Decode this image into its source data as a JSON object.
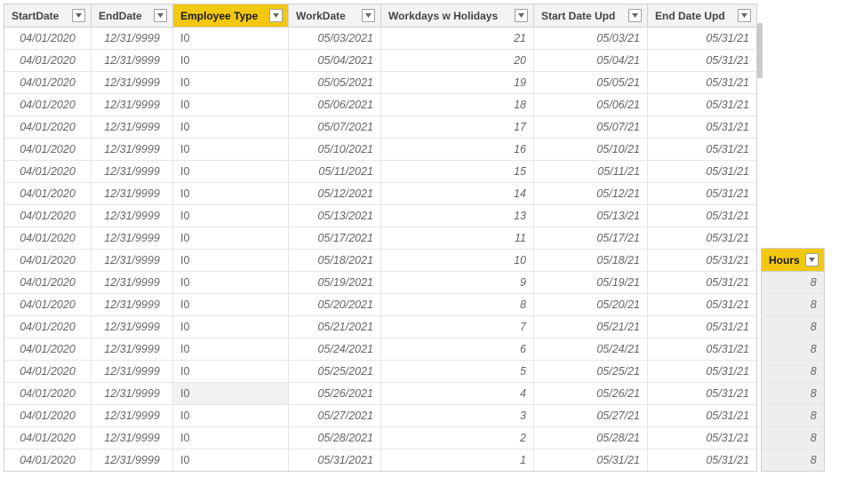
{
  "columns": {
    "start": "StartDate",
    "end": "EndDate",
    "emp": "Employee Type",
    "work": "WorkDate",
    "wd": "Workdays w Holidays",
    "supd": "Start Date Upd",
    "eupd": "End Date Upd",
    "hours": "Hours"
  },
  "rows": [
    {
      "start": "04/01/2020",
      "end": "12/31/9999",
      "emp": "I0",
      "work": "05/03/2021",
      "wd": "21",
      "supd": "05/03/21",
      "eupd": "05/31/21"
    },
    {
      "start": "04/01/2020",
      "end": "12/31/9999",
      "emp": "I0",
      "work": "05/04/2021",
      "wd": "20",
      "supd": "05/04/21",
      "eupd": "05/31/21"
    },
    {
      "start": "04/01/2020",
      "end": "12/31/9999",
      "emp": "I0",
      "work": "05/05/2021",
      "wd": "19",
      "supd": "05/05/21",
      "eupd": "05/31/21"
    },
    {
      "start": "04/01/2020",
      "end": "12/31/9999",
      "emp": "I0",
      "work": "05/06/2021",
      "wd": "18",
      "supd": "05/06/21",
      "eupd": "05/31/21"
    },
    {
      "start": "04/01/2020",
      "end": "12/31/9999",
      "emp": "I0",
      "work": "05/07/2021",
      "wd": "17",
      "supd": "05/07/21",
      "eupd": "05/31/21"
    },
    {
      "start": "04/01/2020",
      "end": "12/31/9999",
      "emp": "I0",
      "work": "05/10/2021",
      "wd": "16",
      "supd": "05/10/21",
      "eupd": "05/31/21"
    },
    {
      "start": "04/01/2020",
      "end": "12/31/9999",
      "emp": "I0",
      "work": "05/11/2021",
      "wd": "15",
      "supd": "05/11/21",
      "eupd": "05/31/21"
    },
    {
      "start": "04/01/2020",
      "end": "12/31/9999",
      "emp": "I0",
      "work": "05/12/2021",
      "wd": "14",
      "supd": "05/12/21",
      "eupd": "05/31/21"
    },
    {
      "start": "04/01/2020",
      "end": "12/31/9999",
      "emp": "I0",
      "work": "05/13/2021",
      "wd": "13",
      "supd": "05/13/21",
      "eupd": "05/31/21"
    },
    {
      "start": "04/01/2020",
      "end": "12/31/9999",
      "emp": "I0",
      "work": "05/17/2021",
      "wd": "11",
      "supd": "05/17/21",
      "eupd": "05/31/21"
    },
    {
      "start": "04/01/2020",
      "end": "12/31/9999",
      "emp": "I0",
      "work": "05/18/2021",
      "wd": "10",
      "supd": "05/18/21",
      "eupd": "05/31/21"
    },
    {
      "start": "04/01/2020",
      "end": "12/31/9999",
      "emp": "I0",
      "work": "05/19/2021",
      "wd": "9",
      "supd": "05/19/21",
      "eupd": "05/31/21"
    },
    {
      "start": "04/01/2020",
      "end": "12/31/9999",
      "emp": "I0",
      "work": "05/20/2021",
      "wd": "8",
      "supd": "05/20/21",
      "eupd": "05/31/21"
    },
    {
      "start": "04/01/2020",
      "end": "12/31/9999",
      "emp": "I0",
      "work": "05/21/2021",
      "wd": "7",
      "supd": "05/21/21",
      "eupd": "05/31/21"
    },
    {
      "start": "04/01/2020",
      "end": "12/31/9999",
      "emp": "I0",
      "work": "05/24/2021",
      "wd": "6",
      "supd": "05/24/21",
      "eupd": "05/31/21"
    },
    {
      "start": "04/01/2020",
      "end": "12/31/9999",
      "emp": "I0",
      "work": "05/25/2021",
      "wd": "5",
      "supd": "05/25/21",
      "eupd": "05/31/21"
    },
    {
      "start": "04/01/2020",
      "end": "12/31/9999",
      "emp": "I0",
      "work": "05/26/2021",
      "wd": "4",
      "supd": "05/26/21",
      "eupd": "05/31/21",
      "selected": true
    },
    {
      "start": "04/01/2020",
      "end": "12/31/9999",
      "emp": "I0",
      "work": "05/27/2021",
      "wd": "3",
      "supd": "05/27/21",
      "eupd": "05/31/21"
    },
    {
      "start": "04/01/2020",
      "end": "12/31/9999",
      "emp": "I0",
      "work": "05/28/2021",
      "wd": "2",
      "supd": "05/28/21",
      "eupd": "05/31/21"
    },
    {
      "start": "04/01/2020",
      "end": "12/31/9999",
      "emp": "I0",
      "work": "05/31/2021",
      "wd": "1",
      "supd": "05/31/21",
      "eupd": "05/31/21"
    }
  ],
  "hours_rows": [
    "8",
    "8",
    "8",
    "8",
    "8",
    "8",
    "8",
    "8",
    "8"
  ]
}
